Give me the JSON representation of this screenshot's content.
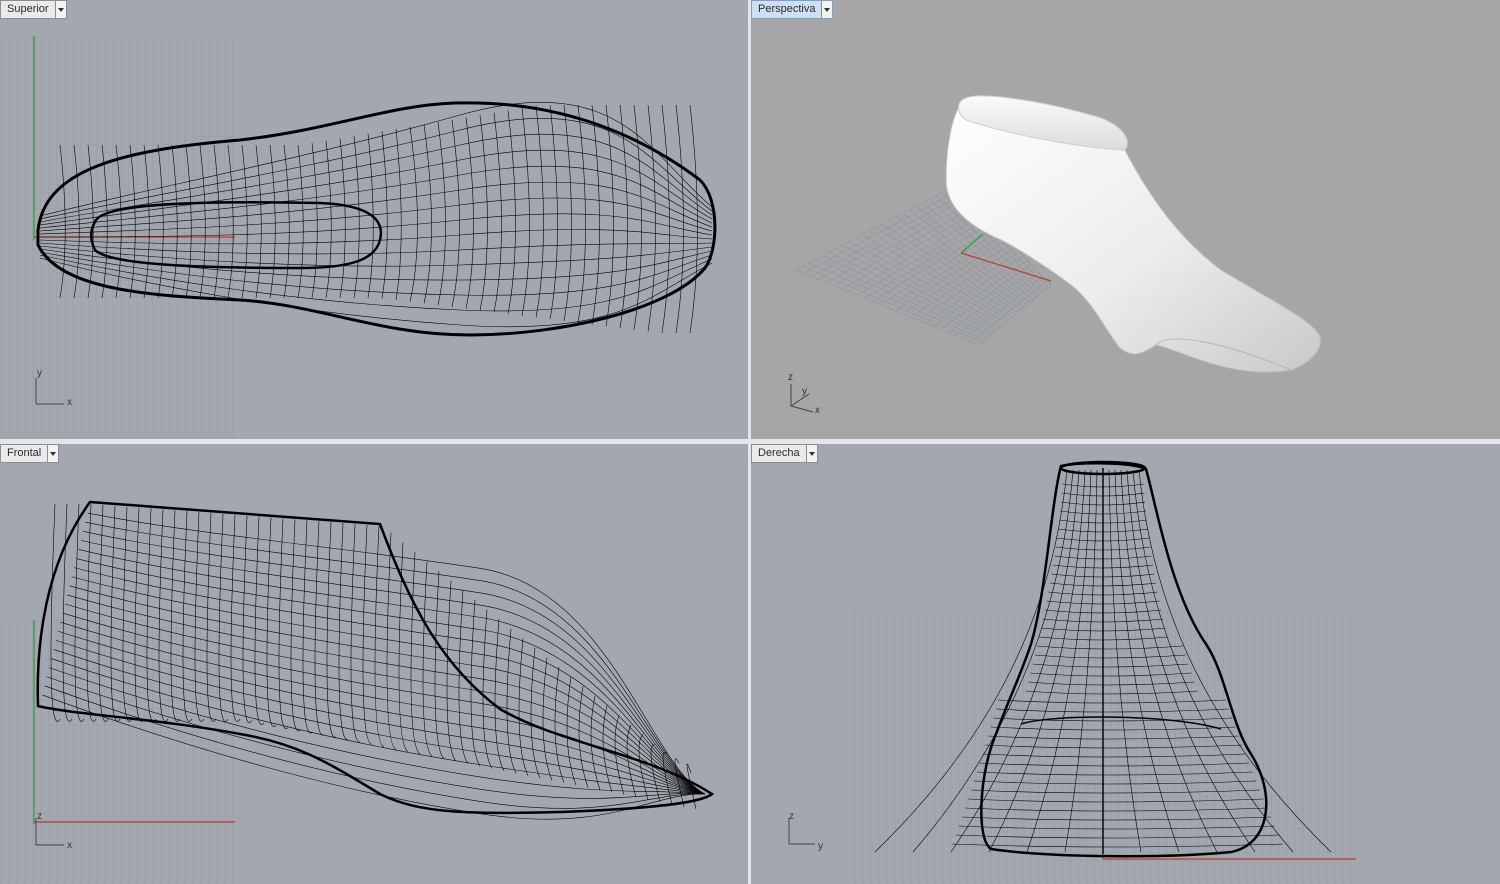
{
  "viewports": {
    "top": {
      "label": "Superior",
      "axis_a": "y",
      "axis_b": "x"
    },
    "perspective": {
      "label": "Perspectiva",
      "axis_a": "z",
      "axis_b": "y",
      "axis_c": "x"
    },
    "front": {
      "label": "Frontal",
      "axis_a": "z",
      "axis_b": "x"
    },
    "right": {
      "label": "Derecha",
      "axis_a": "z",
      "axis_b": "y"
    }
  },
  "colors": {
    "viewport_bg": "#a3a8b0",
    "perspective_bg": "#a6a6a6",
    "grid_line": "#8e939b",
    "wireframe": "#000000",
    "x_axis": "#c0392b",
    "y_axis": "#2e9b3a"
  }
}
